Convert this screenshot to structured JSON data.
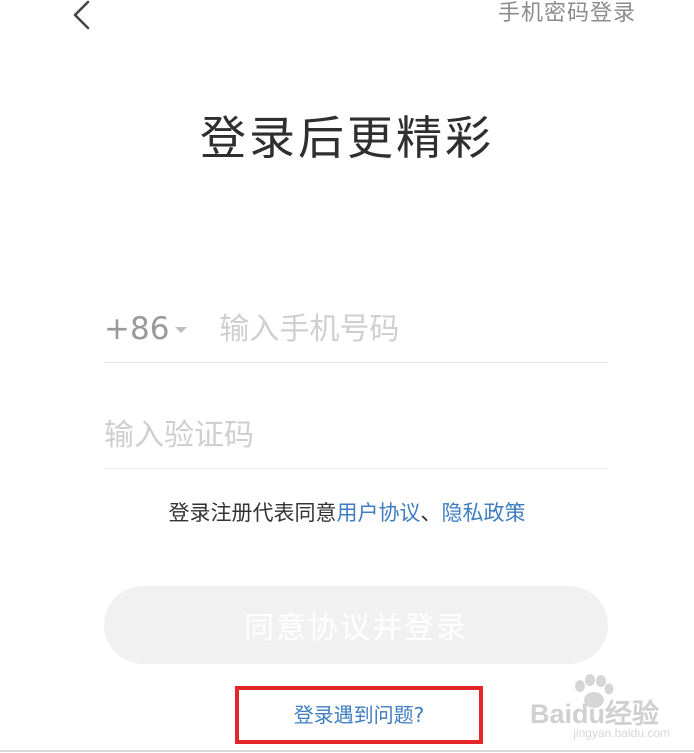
{
  "header": {
    "back_icon": "chevron-left-icon",
    "password_login_label": "手机密码登录"
  },
  "main": {
    "title": "登录后更精彩",
    "phone": {
      "country_code": "+86",
      "placeholder": "输入手机号码",
      "value": ""
    },
    "code": {
      "placeholder": "输入验证码",
      "value": ""
    },
    "agreement": {
      "prefix": "登录注册代表同意",
      "user_agreement": "用户协议",
      "separator": "、",
      "privacy_policy": "隐私政策"
    },
    "login_button_label": "同意协议并登录",
    "help_link_label": "登录遇到问题?"
  },
  "watermark": {
    "brand": "Baidu经验",
    "url": "jingyan.baidu.com"
  },
  "colors": {
    "link": "#3e7dc0",
    "highlight_border": "#e4262b",
    "button_disabled_bg": "#f1f1f1",
    "placeholder": "#cfcfcf"
  }
}
